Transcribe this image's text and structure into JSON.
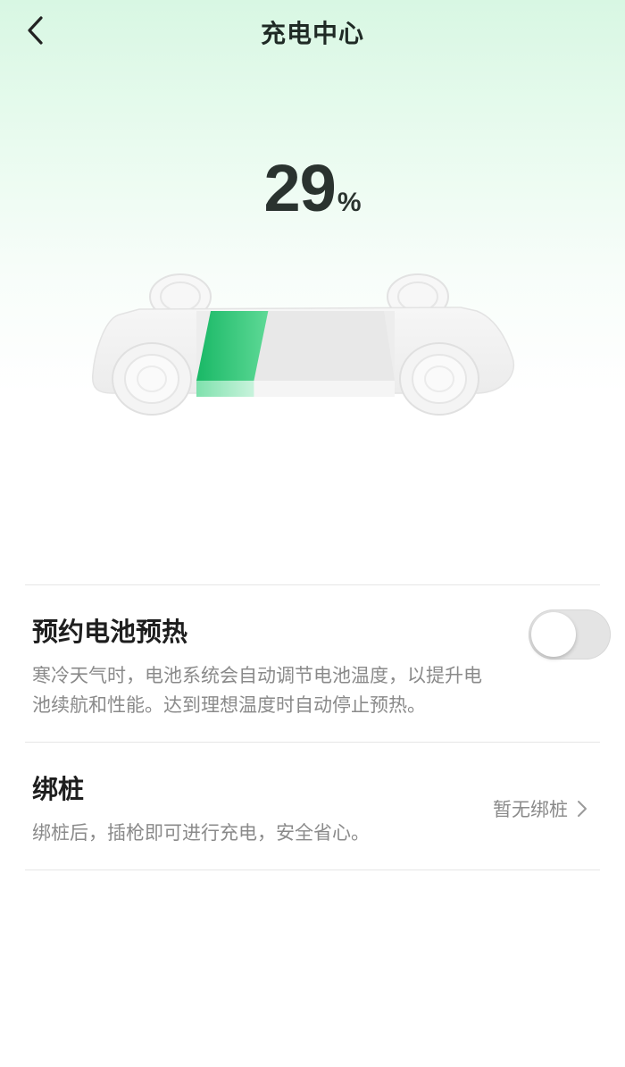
{
  "nav": {
    "title": "充电中心",
    "back_icon": "chevron-left-icon"
  },
  "battery": {
    "level": 29,
    "value_text": "29",
    "unit": "%",
    "accent": "#1cc26a"
  },
  "preheat": {
    "title": "预约电池预热",
    "description": "寒冷天气时，电池系统会自动调节电池温度，以提升电池续航和性能。达到理想温度时自动停止预热。",
    "enabled": false
  },
  "pile": {
    "title": "绑桩",
    "description": "绑桩后，插枪即可进行充电，安全省心。",
    "status": "暂无绑桩",
    "chevron_icon": "chevron-right-icon"
  }
}
